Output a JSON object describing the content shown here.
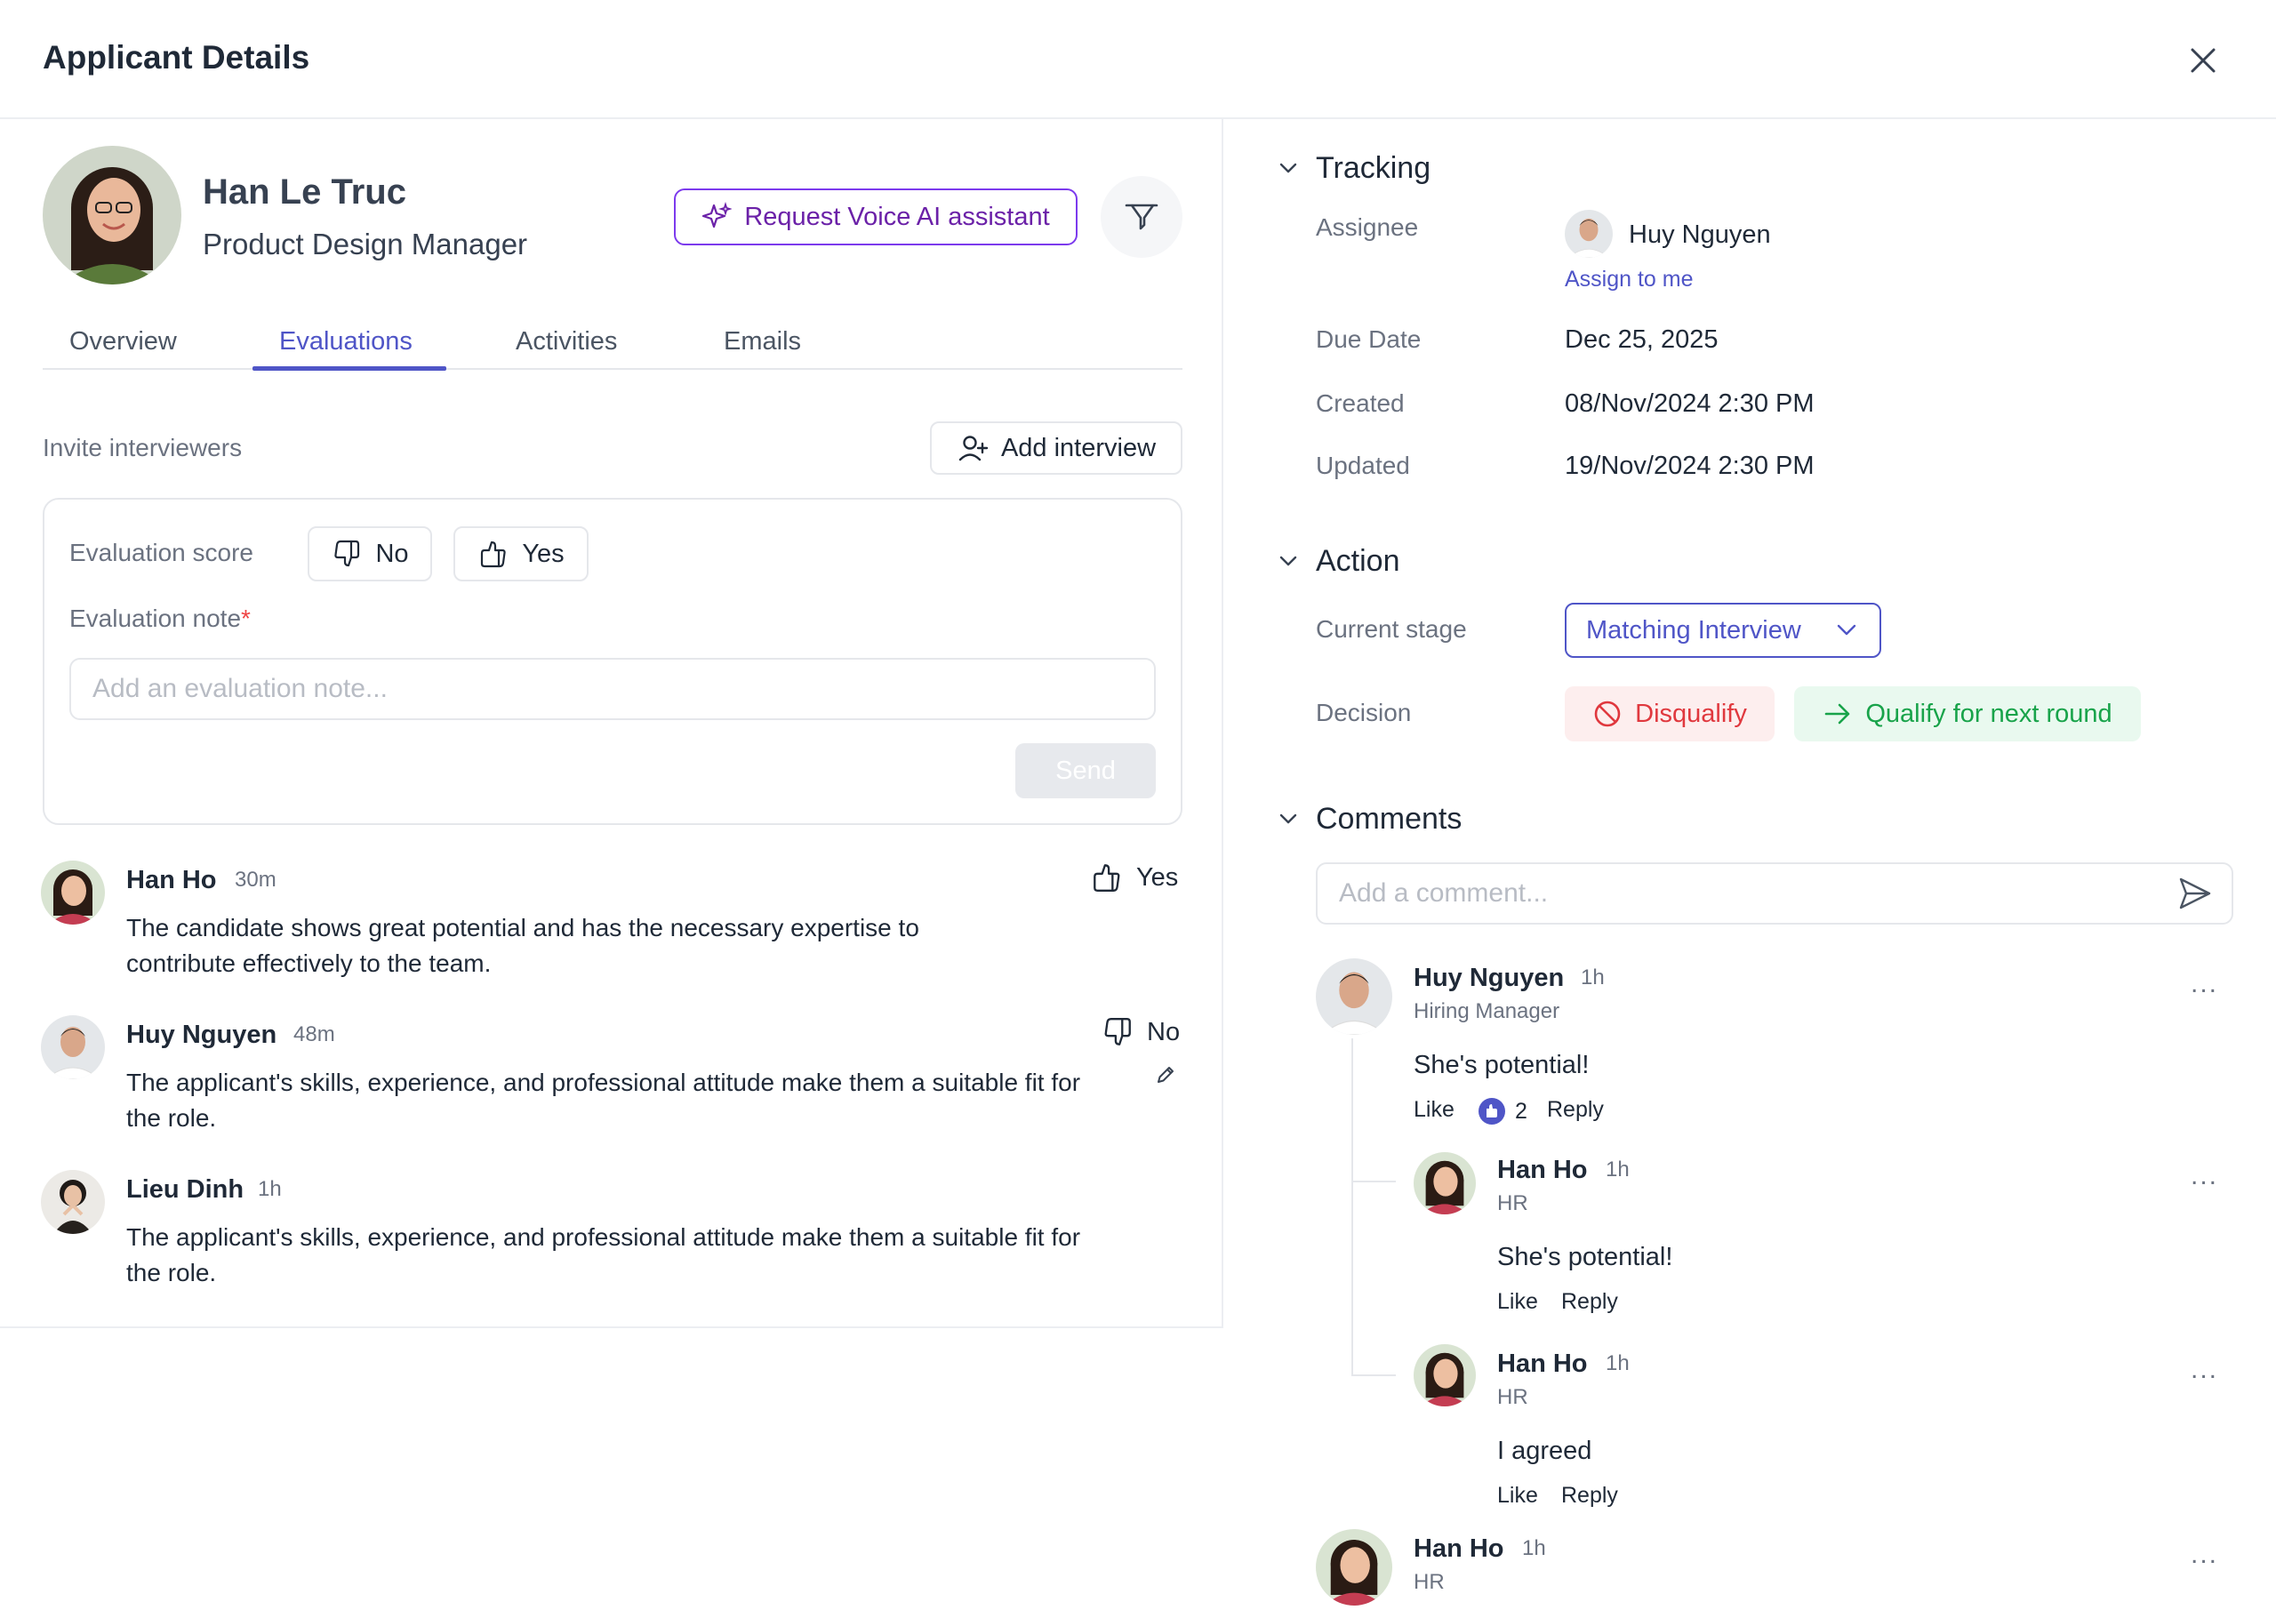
{
  "header": {
    "title": "Applicant Details"
  },
  "applicant": {
    "name": "Han Le Truc",
    "role": "Product Design Manager",
    "voice_button": "Request Voice AI assistant"
  },
  "tabs": [
    {
      "label": "Overview"
    },
    {
      "label": "Evaluations"
    },
    {
      "label": "Activities"
    },
    {
      "label": "Emails"
    }
  ],
  "active_tab": "Evaluations",
  "evaluations": {
    "invite_label": "Invite interviewers",
    "add_interview_label": "Add interview",
    "score_label": "Evaluation score",
    "no_label": "No",
    "yes_label": "Yes",
    "note_label": "Evaluation note",
    "required_mark": "*",
    "note_placeholder": "Add an evaluation note...",
    "send_label": "Send",
    "list": [
      {
        "name": "Han Ho",
        "time": "30m",
        "vote": "Yes",
        "text": "The candidate shows great potential and has the necessary expertise to contribute effectively to the team."
      },
      {
        "name": "Huy Nguyen",
        "time": "48m",
        "vote": "No",
        "text": "The applicant's skills, experience, and professional attitude make them a suitable fit for the role."
      },
      {
        "name": "Lieu Dinh",
        "time": "1h",
        "vote": "",
        "text": "The applicant's skills, experience, and professional attitude make them a suitable fit for the role."
      }
    ]
  },
  "tracking": {
    "title": "Tracking",
    "assignee_label": "Assignee",
    "assignee_name": "Huy Nguyen",
    "assign_to_me": "Assign to me",
    "due_label": "Due Date",
    "due_value": "Dec 25, 2025",
    "created_label": "Created",
    "created_value": "08/Nov/2024 2:30 PM",
    "updated_label": "Updated",
    "updated_value": "19/Nov/2024 2:30 PM"
  },
  "action": {
    "title": "Action",
    "stage_label": "Current stage",
    "stage_value": "Matching Interview",
    "decision_label": "Decision",
    "disqualify_label": "Disqualify",
    "qualify_label": "Qualify for next round"
  },
  "comments": {
    "title": "Comments",
    "placeholder": "Add a comment...",
    "like_label": "Like",
    "reply_label": "Reply",
    "more_label": "...",
    "items": [
      {
        "name": "Huy Nguyen",
        "time": "1h",
        "role": "Hiring Manager",
        "text": "She's potential!",
        "likes": "2"
      },
      {
        "name": "Han Ho",
        "time": "1h",
        "role": "HR",
        "text": "She's potential!"
      },
      {
        "name": "Han Ho",
        "time": "1h",
        "role": "HR",
        "text": "I agreed"
      },
      {
        "name": "Han Ho",
        "time": "1h",
        "role": "HR"
      }
    ]
  },
  "colors": {
    "accent": "#4f55c7",
    "purple": "#6b21a8",
    "danger": "#e0383e",
    "success": "#18a34a"
  },
  "icons": [
    "close-icon",
    "sparkle-icon",
    "filter-icon",
    "user-plus-icon",
    "thumbs-down-icon",
    "thumbs-up-icon",
    "pencil-icon",
    "chevron-down-icon",
    "ban-icon",
    "arrow-right-icon",
    "send-icon",
    "like-badge-icon"
  ]
}
